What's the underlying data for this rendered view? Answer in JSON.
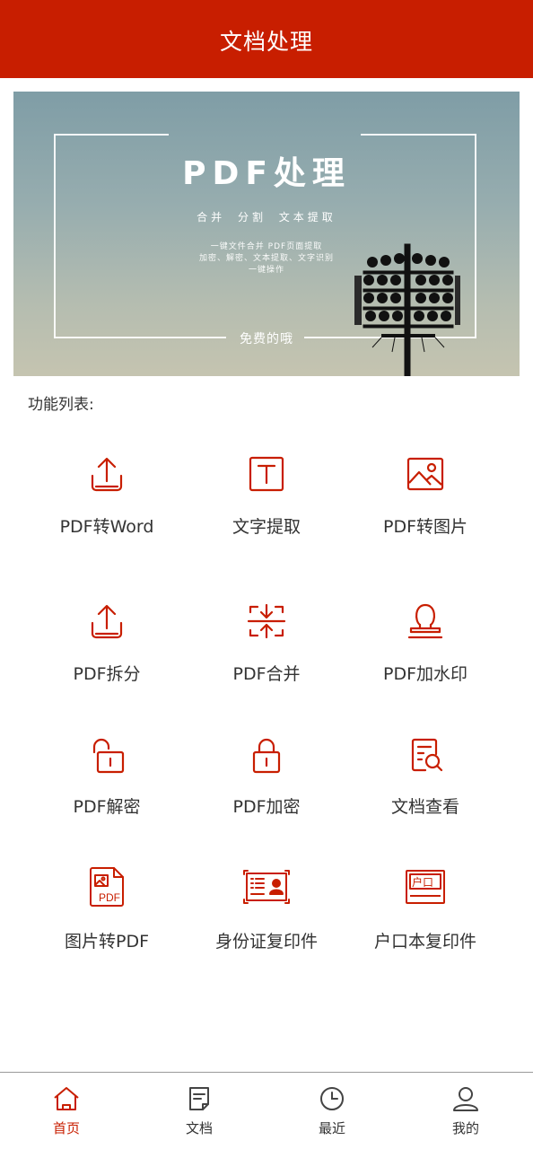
{
  "header": {
    "title": "文档处理"
  },
  "banner": {
    "title": "PDF处理",
    "subtitle": "合并 分割 文本提取",
    "desc_line1": "一键文件合并 PDF页面提取",
    "desc_line2": "加密、解密、文本提取、文字识别",
    "desc_line3": "一键操作",
    "free_text": "免费的哦"
  },
  "section": {
    "label": "功能列表:"
  },
  "features": [
    {
      "label": "PDF转Word",
      "icon": "upload-tray-icon"
    },
    {
      "label": "文字提取",
      "icon": "text-box-icon"
    },
    {
      "label": "PDF转图片",
      "icon": "image-icon"
    },
    {
      "label": "PDF拆分",
      "icon": "upload-tray-icon"
    },
    {
      "label": "PDF合并",
      "icon": "merge-arrows-icon"
    },
    {
      "label": "PDF加水印",
      "icon": "stamp-icon"
    },
    {
      "label": "PDF解密",
      "icon": "unlocked-padlock-icon"
    },
    {
      "label": "PDF加密",
      "icon": "locked-padlock-icon"
    },
    {
      "label": "文档查看",
      "icon": "document-search-icon"
    },
    {
      "label": "图片转PDF",
      "icon": "image-to-pdf-icon"
    },
    {
      "label": "身份证复印件",
      "icon": "id-card-icon"
    },
    {
      "label": "户口本复印件",
      "icon": "household-register-icon"
    }
  ],
  "pdf_badge_text": "PDF",
  "hukou_badge_text": "户口",
  "nav": [
    {
      "label": "首页",
      "icon": "home-icon",
      "active": true
    },
    {
      "label": "文档",
      "icon": "document-icon",
      "active": false
    },
    {
      "label": "最近",
      "icon": "clock-icon",
      "active": false
    },
    {
      "label": "我的",
      "icon": "user-icon",
      "active": false
    }
  ],
  "colors": {
    "accent": "#C81E00",
    "text": "#333333",
    "nav_border": "#9a9a9a"
  }
}
